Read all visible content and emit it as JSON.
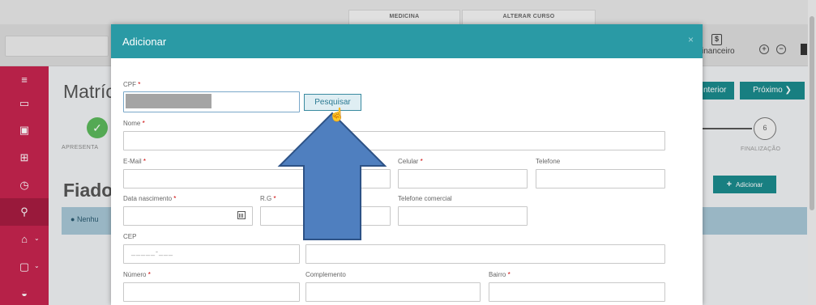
{
  "top_tabs": [
    "MEDICINA",
    "ALTERAR CURSO"
  ],
  "header": {
    "financeiro_label": "inanceiro",
    "financeiro_icon": "dollar-doc-icon"
  },
  "sidebar": {
    "items": [
      {
        "icon": "menu-icon",
        "glyph": "≡"
      },
      {
        "icon": "monitor-icon",
        "glyph": "▭"
      },
      {
        "icon": "calendar-icon",
        "glyph": "▣"
      },
      {
        "icon": "grid-icon",
        "glyph": "⊞"
      },
      {
        "icon": "clock-icon",
        "glyph": "◷"
      },
      {
        "icon": "add-user-icon",
        "glyph": "⚲"
      },
      {
        "icon": "graduation-cap-icon",
        "glyph": "⌂"
      },
      {
        "icon": "clipboard-icon",
        "glyph": "▢"
      },
      {
        "icon": "inbox-icon",
        "glyph": "◒"
      }
    ]
  },
  "background": {
    "title": "Matríc",
    "section_title": "Fiado",
    "step_first_label": "APRESENTA",
    "step_last_label": "FINALIZAÇÃO",
    "step_last_number": "6",
    "alert_text": "Nenhu",
    "prev_label": "nterior",
    "next_label": "Próximo",
    "add_label": "Adicionar"
  },
  "modal": {
    "title": "Adicionar",
    "cpf_label": "CPF",
    "search_button": "Pesquisar",
    "nome_label": "Nome",
    "email_label": "E-Mail",
    "celular_label": "Celular",
    "telefone_label": "Telefone",
    "nascimento_label": "Data nascimento",
    "rg_label": "R.G",
    "telefone_comercial_label": "Telefone comercial",
    "cep_label": "CEP",
    "cep_value": "_____-___",
    "numero_label": "Número",
    "complemento_label": "Complemento",
    "bairro_label": "Bairro",
    "required_mark": "*"
  },
  "colors": {
    "sidebar": "#c6244f",
    "modal_header": "#2a9aa5",
    "primary_button": "#1b8a8c",
    "arrow_fill": "#4f7fbf",
    "arrow_stroke": "#2d5286"
  }
}
